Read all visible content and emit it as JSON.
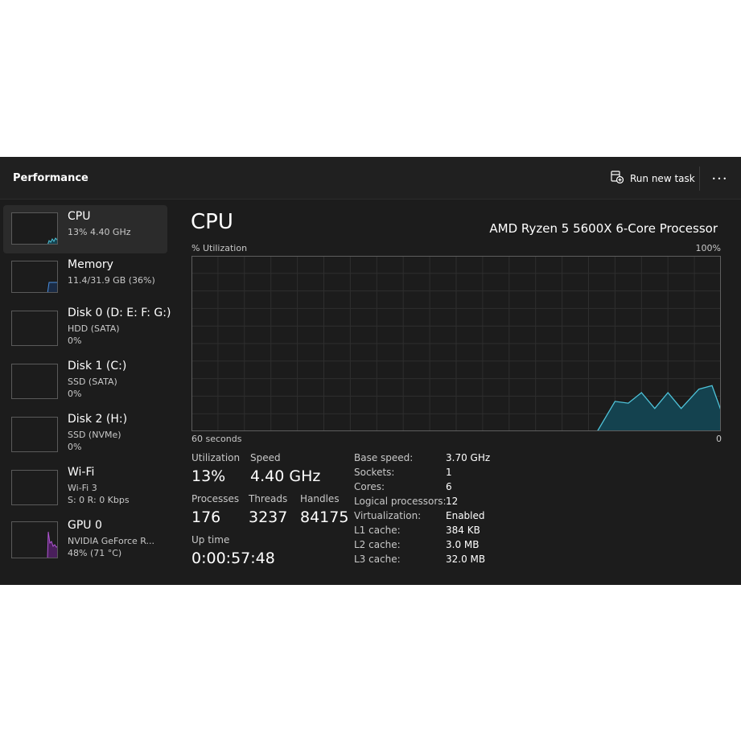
{
  "header": {
    "title": "Performance",
    "run_new_task_label": "Run new task",
    "more_label": "•••"
  },
  "sidebar": {
    "items": [
      {
        "name": "CPU",
        "sub1": "13% 4.40 GHz",
        "sub2": "",
        "selected": true,
        "graph_color": "#4fc3d9"
      },
      {
        "name": "Memory",
        "sub1": "11.4/31.9 GB (36%)",
        "sub2": "",
        "graph_color": "#4a8fe0"
      },
      {
        "name": "Disk 0 (D: E: F: G:)",
        "sub1": "HDD (SATA)",
        "sub2": "0%"
      },
      {
        "name": "Disk 1 (C:)",
        "sub1": "SSD (SATA)",
        "sub2": "0%"
      },
      {
        "name": "Disk 2 (H:)",
        "sub1": "SSD (NVMe)",
        "sub2": "0%"
      },
      {
        "name": "Wi-Fi",
        "sub1": "Wi-Fi 3",
        "sub2": "S: 0 R: 0 Kbps"
      },
      {
        "name": "GPU 0",
        "sub1": "NVIDIA GeForce R...",
        "sub2": "48% (71 °C)",
        "graph_color": "#b257d6"
      }
    ]
  },
  "main": {
    "title": "CPU",
    "processor": "AMD Ryzen 5 5600X 6-Core Processor",
    "graph": {
      "ylabel": "% Utilization",
      "ymax_label": "100%",
      "xlabel_left": "60 seconds",
      "xlabel_right": "0",
      "line_color": "#4fc3d9",
      "fill_color": "#14424f"
    },
    "stats": {
      "utilization_label": "Utilization",
      "utilization_value": "13%",
      "speed_label": "Speed",
      "speed_value": "4.40 GHz",
      "processes_label": "Processes",
      "processes_value": "176",
      "threads_label": "Threads",
      "threads_value": "3237",
      "handles_label": "Handles",
      "handles_value": "84175",
      "uptime_label": "Up time",
      "uptime_value": "0:00:57:48"
    },
    "specs": [
      {
        "label": "Base speed:",
        "value": "3.70 GHz"
      },
      {
        "label": "Sockets:",
        "value": "1"
      },
      {
        "label": "Cores:",
        "value": "6"
      },
      {
        "label": "Logical processors:",
        "value": "12"
      },
      {
        "label": "Virtualization:",
        "value": "Enabled"
      },
      {
        "label": "L1 cache:",
        "value": "384 KB"
      },
      {
        "label": "L2 cache:",
        "value": "3.0 MB"
      },
      {
        "label": "L3 cache:",
        "value": "32.0 MB"
      }
    ]
  },
  "chart_data": {
    "type": "area",
    "ylabel": "% Utilization",
    "xlabel": "60 seconds",
    "ylim": [
      0,
      100
    ],
    "xlim": [
      60,
      0
    ],
    "grid": true,
    "series": [
      {
        "x": [
          60,
          14,
          12,
          10.5,
          9,
          7.5,
          6,
          4.5,
          2.5,
          1,
          0
        ],
        "values": [
          0,
          0,
          17,
          16,
          22,
          13,
          22,
          13,
          24,
          26,
          12
        ]
      }
    ]
  }
}
